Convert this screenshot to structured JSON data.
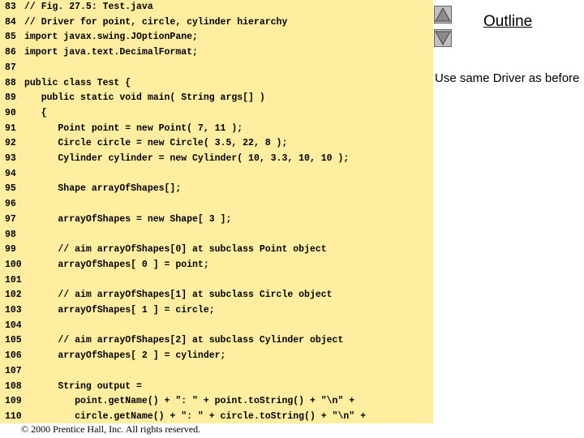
{
  "code": {
    "lines": [
      {
        "num": "83",
        "text": "// Fig. 27.5: Test.java"
      },
      {
        "num": "84",
        "text": "// Driver for point, circle, cylinder hierarchy"
      },
      {
        "num": "85",
        "text": "import javax.swing.JOptionPane;"
      },
      {
        "num": "86",
        "text": "import java.text.DecimalFormat;"
      },
      {
        "num": "87",
        "text": ""
      },
      {
        "num": "88",
        "text": "public class Test {"
      },
      {
        "num": "89",
        "text": "   public static void main( String args[] )"
      },
      {
        "num": "90",
        "text": "   {"
      },
      {
        "num": "91",
        "text": "      Point point = new Point( 7, 11 );"
      },
      {
        "num": "92",
        "text": "      Circle circle = new Circle( 3.5, 22, 8 );"
      },
      {
        "num": "93",
        "text": "      Cylinder cylinder = new Cylinder( 10, 3.3, 10, 10 );"
      },
      {
        "num": "94",
        "text": ""
      },
      {
        "num": "95",
        "text": "      Shape arrayOfShapes[];"
      },
      {
        "num": "96",
        "text": ""
      },
      {
        "num": "97",
        "text": "      arrayOfShapes = new Shape[ 3 ];"
      },
      {
        "num": "98",
        "text": ""
      },
      {
        "num": "99",
        "text": "      // aim arrayOfShapes[0] at subclass Point object"
      },
      {
        "num": "100",
        "text": "      arrayOfShapes[ 0 ] = point;"
      },
      {
        "num": "101",
        "text": ""
      },
      {
        "num": "102",
        "text": "      // aim arrayOfShapes[1] at subclass Circle object"
      },
      {
        "num": "103",
        "text": "      arrayOfShapes[ 1 ] = circle;"
      },
      {
        "num": "104",
        "text": ""
      },
      {
        "num": "105",
        "text": "      // aim arrayOfShapes[2] at subclass Cylinder object"
      },
      {
        "num": "106",
        "text": "      arrayOfShapes[ 2 ] = cylinder;"
      },
      {
        "num": "107",
        "text": ""
      },
      {
        "num": "108",
        "text": "      String output ="
      },
      {
        "num": "109",
        "text": "         point.getName() + \": \" + point.toString() + \"\\n\" +"
      },
      {
        "num": "110",
        "text": "         circle.getName() + \": \" + circle.toString() + \"\\n\" +"
      }
    ]
  },
  "sidebar": {
    "outline_title": "Outline",
    "note": "Use same Driver as before"
  },
  "footer": {
    "copyright": "© 2000 Prentice Hall, Inc.  All rights reserved."
  },
  "nav": {
    "up_icon": "triangle-up-icon",
    "down_icon": "triangle-down-icon"
  },
  "colors": {
    "code_background": "#ffeea0",
    "button_face": "#c0c0c0",
    "keyword": "#000080"
  }
}
